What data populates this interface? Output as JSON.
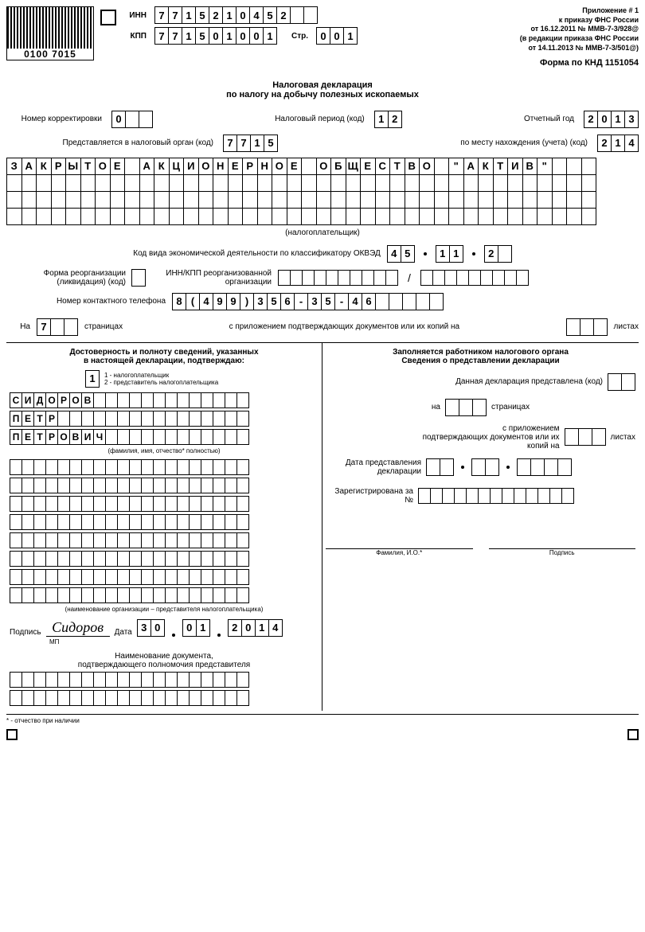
{
  "barcode_text": "0100 7015",
  "header": {
    "inn_label": "ИНН",
    "inn": [
      "7",
      "7",
      "1",
      "5",
      "2",
      "1",
      "0",
      "4",
      "5",
      "2",
      "",
      ""
    ],
    "kpp_label": "КПП",
    "kpp": [
      "7",
      "7",
      "1",
      "5",
      "0",
      "1",
      "0",
      "0",
      "1"
    ],
    "page_label": "Стр.",
    "page": [
      "0",
      "0",
      "1"
    ],
    "right1": "Приложение # 1",
    "right2": "к приказу ФНС России",
    "right3": "от 16.12.2011 № ММВ-7-3/928@",
    "right4": "(в редакции приказа ФНС России",
    "right5": "от 14.11.2013 № ММВ-7-3/501@)",
    "form_code": "Форма по КНД 1151054"
  },
  "title1": "Налоговая декларация",
  "title2": "по налогу на добычу полезных ископаемых",
  "corr_label": "Номер корректировки",
  "corr": [
    "0",
    "",
    ""
  ],
  "period_label": "Налоговый период (код)",
  "period": [
    "1",
    "2"
  ],
  "year_label": "Отчетный год",
  "year": [
    "2",
    "0",
    "1",
    "3"
  ],
  "organ_label": "Представляется в налоговый орган (код)",
  "organ": [
    "7",
    "7",
    "1",
    "5"
  ],
  "place_label": "по месту нахождения (учета) (код)",
  "place": [
    "2",
    "1",
    "4"
  ],
  "org_name_rows": [
    [
      "З",
      "А",
      "К",
      "Р",
      "Ы",
      "Т",
      "О",
      "Е",
      "",
      "А",
      "К",
      "Ц",
      "И",
      "О",
      "Н",
      "Е",
      "Р",
      "Н",
      "О",
      "Е",
      "",
      "О",
      "Б",
      "Щ",
      "Е",
      "С",
      "Т",
      "В",
      "О",
      "",
      "\"",
      "А",
      "К",
      "Т",
      "И",
      "В",
      "\"",
      "",
      "",
      ""
    ],
    [
      "",
      "",
      "",
      "",
      "",
      "",
      "",
      "",
      "",
      "",
      "",
      "",
      "",
      "",
      "",
      "",
      "",
      "",
      "",
      "",
      "",
      "",
      "",
      "",
      "",
      "",
      "",
      "",
      "",
      "",
      "",
      "",
      "",
      "",
      "",
      "",
      "",
      "",
      "",
      ""
    ],
    [
      "",
      "",
      "",
      "",
      "",
      "",
      "",
      "",
      "",
      "",
      "",
      "",
      "",
      "",
      "",
      "",
      "",
      "",
      "",
      "",
      "",
      "",
      "",
      "",
      "",
      "",
      "",
      "",
      "",
      "",
      "",
      "",
      "",
      "",
      "",
      "",
      "",
      "",
      "",
      ""
    ],
    [
      "",
      "",
      "",
      "",
      "",
      "",
      "",
      "",
      "",
      "",
      "",
      "",
      "",
      "",
      "",
      "",
      "",
      "",
      "",
      "",
      "",
      "",
      "",
      "",
      "",
      "",
      "",
      "",
      "",
      "",
      "",
      "",
      "",
      "",
      "",
      "",
      "",
      "",
      "",
      ""
    ]
  ],
  "taxpayer_label": "(налогоплательщик)",
  "okved_label": "Код вида экономической деятельности по классификатору ОКВЭД",
  "okved1": [
    "4",
    "5"
  ],
  "okved2": [
    "1",
    "1"
  ],
  "okved3": [
    "2",
    ""
  ],
  "reorg_label1": "Форма реорганизации",
  "reorg_label2": "(ликвидация) (код)",
  "reorg_inn_label1": "ИНН/КПП реорганизованной",
  "reorg_inn_label2": "организации",
  "reorg_inn": [
    "",
    "",
    "",
    "",
    "",
    "",
    "",
    "",
    "",
    ""
  ],
  "reorg_kpp": [
    "",
    "",
    "",
    "",
    "",
    "",
    "",
    "",
    ""
  ],
  "slash": "/",
  "phone_label": "Номер контактного телефона",
  "phone": [
    "8",
    "(",
    "4",
    "9",
    "9",
    ")",
    "3",
    "5",
    "6",
    "-",
    "3",
    "5",
    "-",
    "4",
    "6",
    "",
    "",
    "",
    "",
    ""
  ],
  "pages_on": "На",
  "pages": [
    "7",
    "",
    ""
  ],
  "pages_label": "страницах",
  "attach_label": "с приложением подтверждающих документов или их копий на",
  "attach": [
    "",
    "",
    ""
  ],
  "sheets_label": "листах",
  "left": {
    "title1": "Достоверность и полноту сведений, указанных",
    "title2": "в настоящей декларации, подтверждаю:",
    "type": "1",
    "type1": "1 - налогоплательщик",
    "type2": "2 - представитель налогоплательщика",
    "surname": [
      "С",
      "И",
      "Д",
      "О",
      "Р",
      "О",
      "В",
      "",
      "",
      "",
      "",
      "",
      "",
      "",
      "",
      "",
      "",
      "",
      "",
      ""
    ],
    "name": [
      "П",
      "Е",
      "Т",
      "Р",
      "",
      "",
      "",
      "",
      "",
      "",
      "",
      "",
      "",
      "",
      "",
      "",
      "",
      "",
      "",
      ""
    ],
    "patronymic": [
      "П",
      "Е",
      "Т",
      "Р",
      "О",
      "В",
      "И",
      "Ч",
      "",
      "",
      "",
      "",
      "",
      "",
      "",
      "",
      "",
      "",
      "",
      ""
    ],
    "fio_label": "(фамилия, имя, отчество* полностью)",
    "empty_rows": 8,
    "rep_label": "(наименование организации – представителя налогоплательщика)",
    "sign_label": "Подпись",
    "signature": "Сидоров",
    "mp_label": "МП",
    "date_label": "Дата",
    "date_d": [
      "3",
      "0"
    ],
    "date_m": [
      "0",
      "1"
    ],
    "date_y": [
      "2",
      "0",
      "1",
      "4"
    ],
    "doc_label1": "Наименование документа,",
    "doc_label2": "подтверждающего полномочия представителя",
    "note": "* - отчество при наличии"
  },
  "right": {
    "title1": "Заполняется работником налогового органа",
    "title2": "Сведения о представлении декларации",
    "decl_label": "Данная декларация представлена (код)",
    "decl": [
      "",
      ""
    ],
    "on": "на",
    "pages": [
      "",
      "",
      ""
    ],
    "pages_label": "страницах",
    "attach_label1": "с приложением",
    "attach_label2": "подтверждающих документов или их",
    "attach_label3": "копий на",
    "attach": [
      "",
      "",
      ""
    ],
    "sheets_label": "листах",
    "date_label1": "Дата представления",
    "date_label2": "декларации",
    "date_d": [
      "",
      ""
    ],
    "date_m": [
      "",
      ""
    ],
    "date_y": [
      "",
      "",
      "",
      ""
    ],
    "reg_label1": "Зарегистрирована за",
    "reg_label2": "№",
    "reg": [
      "",
      "",
      "",
      "",
      "",
      "",
      "",
      "",
      "",
      "",
      "",
      "",
      ""
    ],
    "fio_label": "Фамилия, И.О.*",
    "sign_label": "Подпись"
  }
}
